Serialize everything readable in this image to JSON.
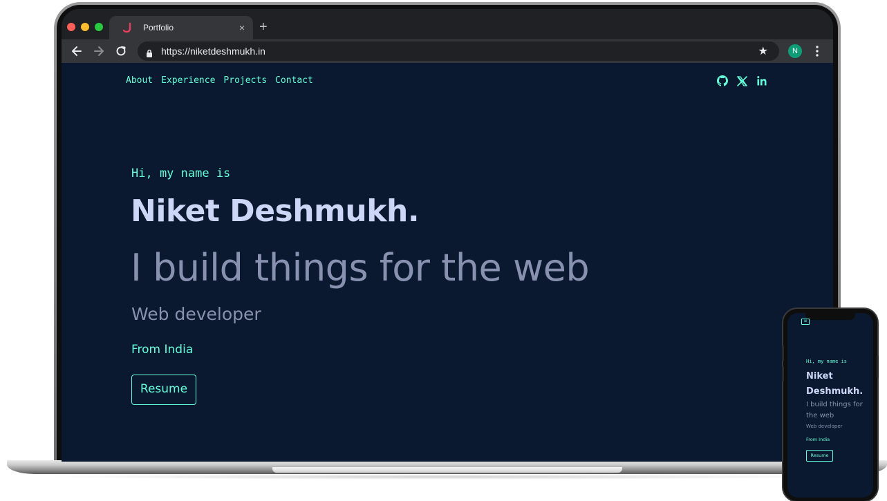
{
  "browser": {
    "tab_title": "Portfolio",
    "tab_close": "×",
    "new_tab": "+",
    "url": "https://niketdeshmukh.in",
    "profile_initial": "N",
    "star": "★"
  },
  "site": {
    "nav": [
      "About",
      "Experience",
      "Projects",
      "Contact"
    ],
    "social_icons": [
      "github-icon",
      "x-icon",
      "linkedin-icon"
    ],
    "intro": "Hi, my name is",
    "name": "Niket Deshmukh.",
    "tagline": "I build things for the web",
    "role": "Web developer",
    "location": "From India",
    "resume": "Resume"
  },
  "phone": {
    "menu_icon": "≡",
    "intro": "Hi, my name is",
    "name": "Niket Deshmukh.",
    "tagline": "I build things for the web",
    "role": "Web developer",
    "location": "From India",
    "resume": "Resume"
  },
  "colors": {
    "background": "#0a192f",
    "accent": "#64ffda",
    "heading": "#ccd6f6",
    "muted": "#8892b0"
  }
}
